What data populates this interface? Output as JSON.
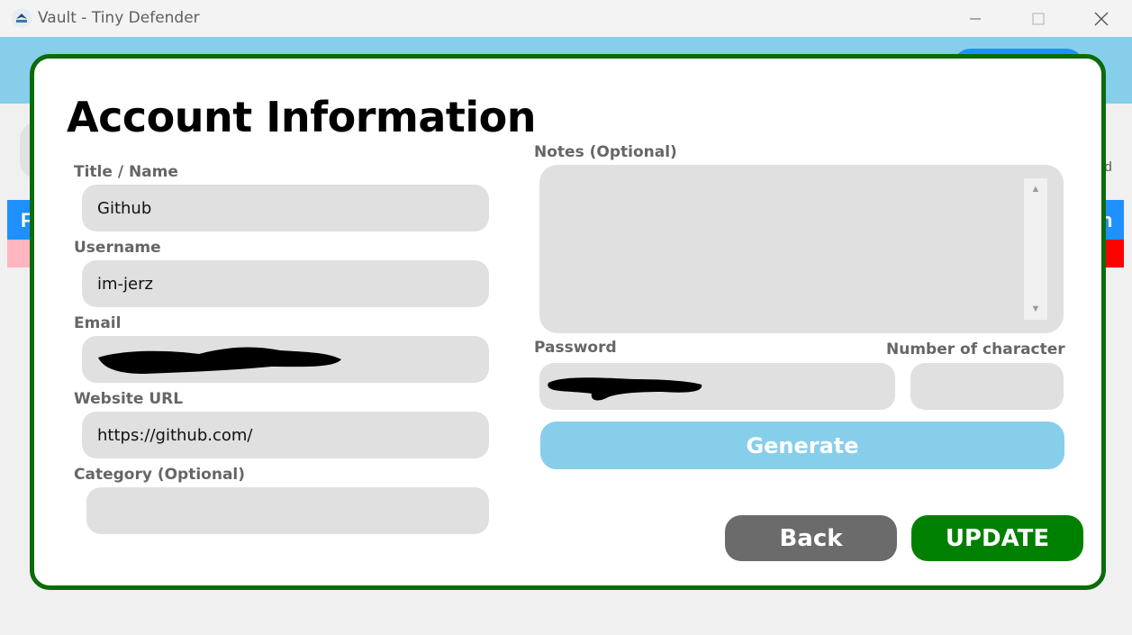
{
  "window": {
    "title": "Vault - Tiny Defender",
    "icon": "app-logo-icon",
    "controls": [
      "minimize-icon",
      "maximize-icon",
      "close-icon"
    ]
  },
  "background": {
    "blue_bar_left": "F",
    "blue_bar_right": "n",
    "side_text": [
      "n",
      "d",
      "ord"
    ]
  },
  "modal": {
    "title": "Account Information",
    "fields": {
      "title": {
        "label": "Title / Name",
        "value": "Github"
      },
      "username": {
        "label": "Username",
        "value": "im-jerz"
      },
      "email": {
        "label": "Email",
        "value": ""
      },
      "website": {
        "label": "Website URL",
        "value": "https://github.com/"
      },
      "category": {
        "label": "Category (Optional)",
        "value": ""
      },
      "notes": {
        "label": "Notes (Optional)",
        "value": ""
      },
      "password": {
        "label": "Password",
        "value": ""
      },
      "num_chars": {
        "label": "Number of character",
        "value": ""
      }
    },
    "buttons": {
      "generate": "Generate",
      "back": "Back",
      "update": "UPDATE"
    }
  },
  "colors": {
    "modal_border": "#0b6b0b",
    "header_bg": "#87ceeb",
    "generate_bg": "#87ceeb",
    "back_bg": "#6b6b6b",
    "update_bg": "#008000",
    "field_bg": "#e0e0e0"
  }
}
